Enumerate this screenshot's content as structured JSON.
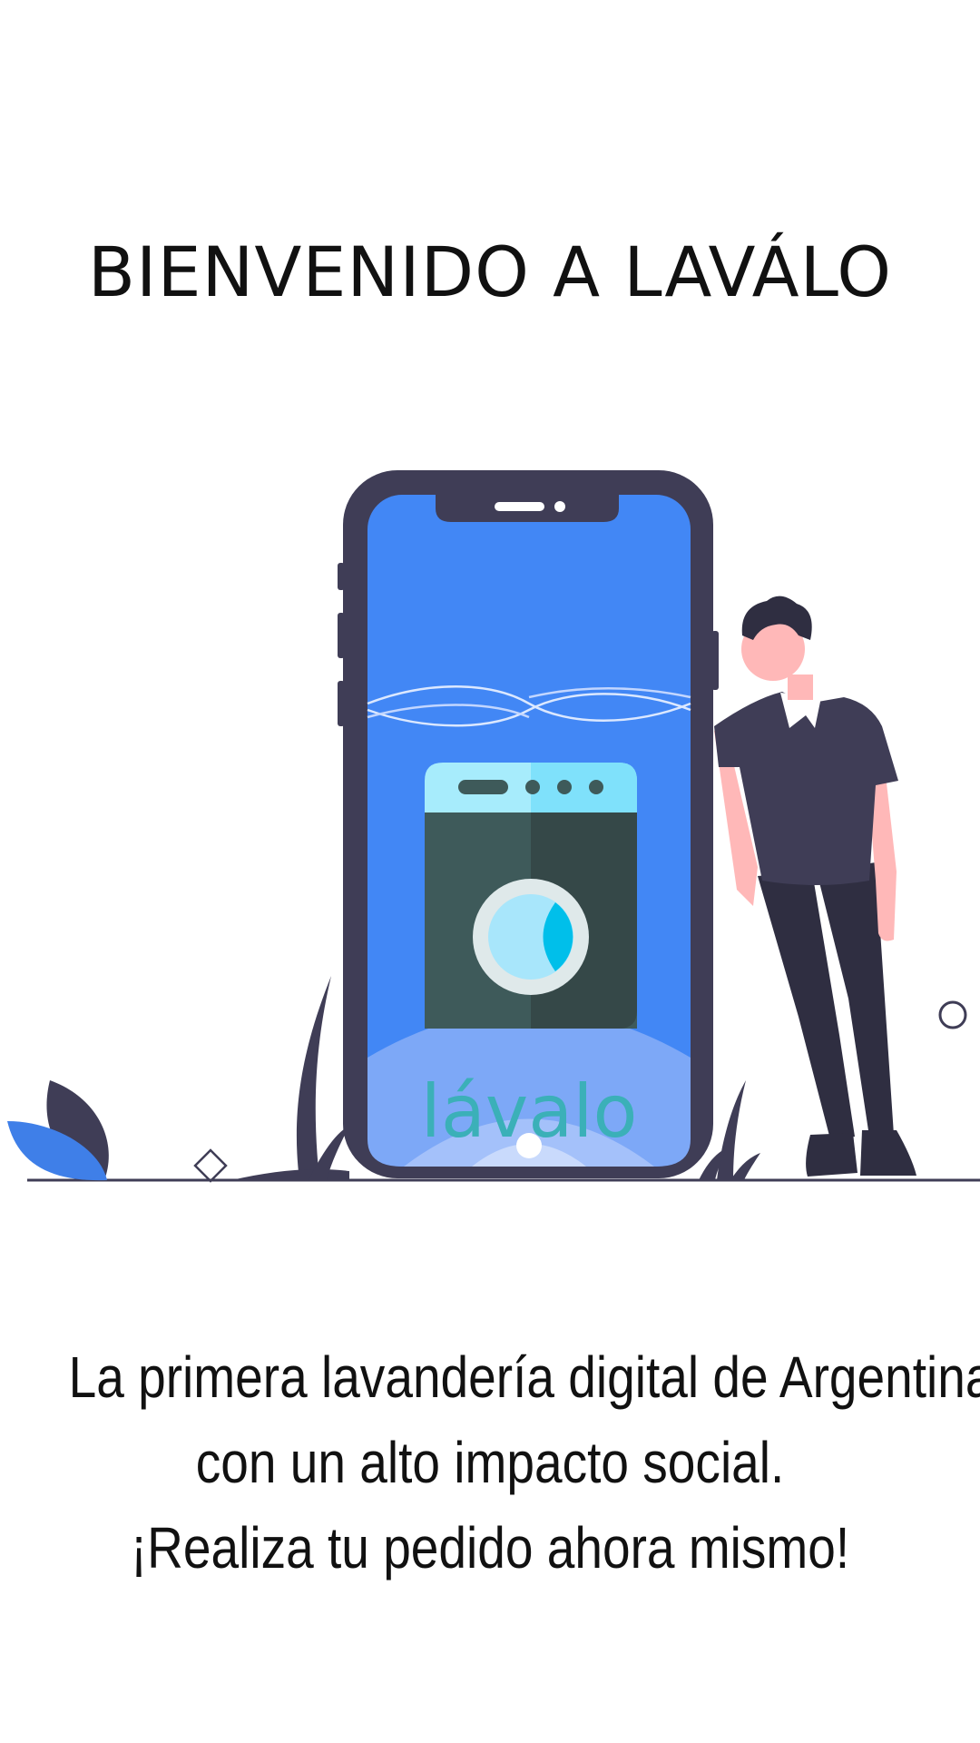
{
  "screen": {
    "title": "BIENVENIDO A LAVÁLO",
    "tagline": [
      "La primera lavandería digital de Argentina",
      "con un alto impacto social.",
      "¡Realiza tu pedido ahora mismo!"
    ]
  },
  "illustration": {
    "brand_logo_text": "lávalo",
    "icons": [
      "phone-mockup",
      "washing-machine-icon",
      "person-illustration",
      "leaf-decoration"
    ]
  },
  "colors": {
    "phone_frame": "#3f3d56",
    "phone_screen": "#4287f5",
    "washer_body": "#3e5a5a",
    "washer_top": "#9be7fb",
    "washer_drum": "#00bfea",
    "skin": "#ffb8b8",
    "brand_text": "#3bb0b8",
    "leaf": "#3f7fe8"
  }
}
